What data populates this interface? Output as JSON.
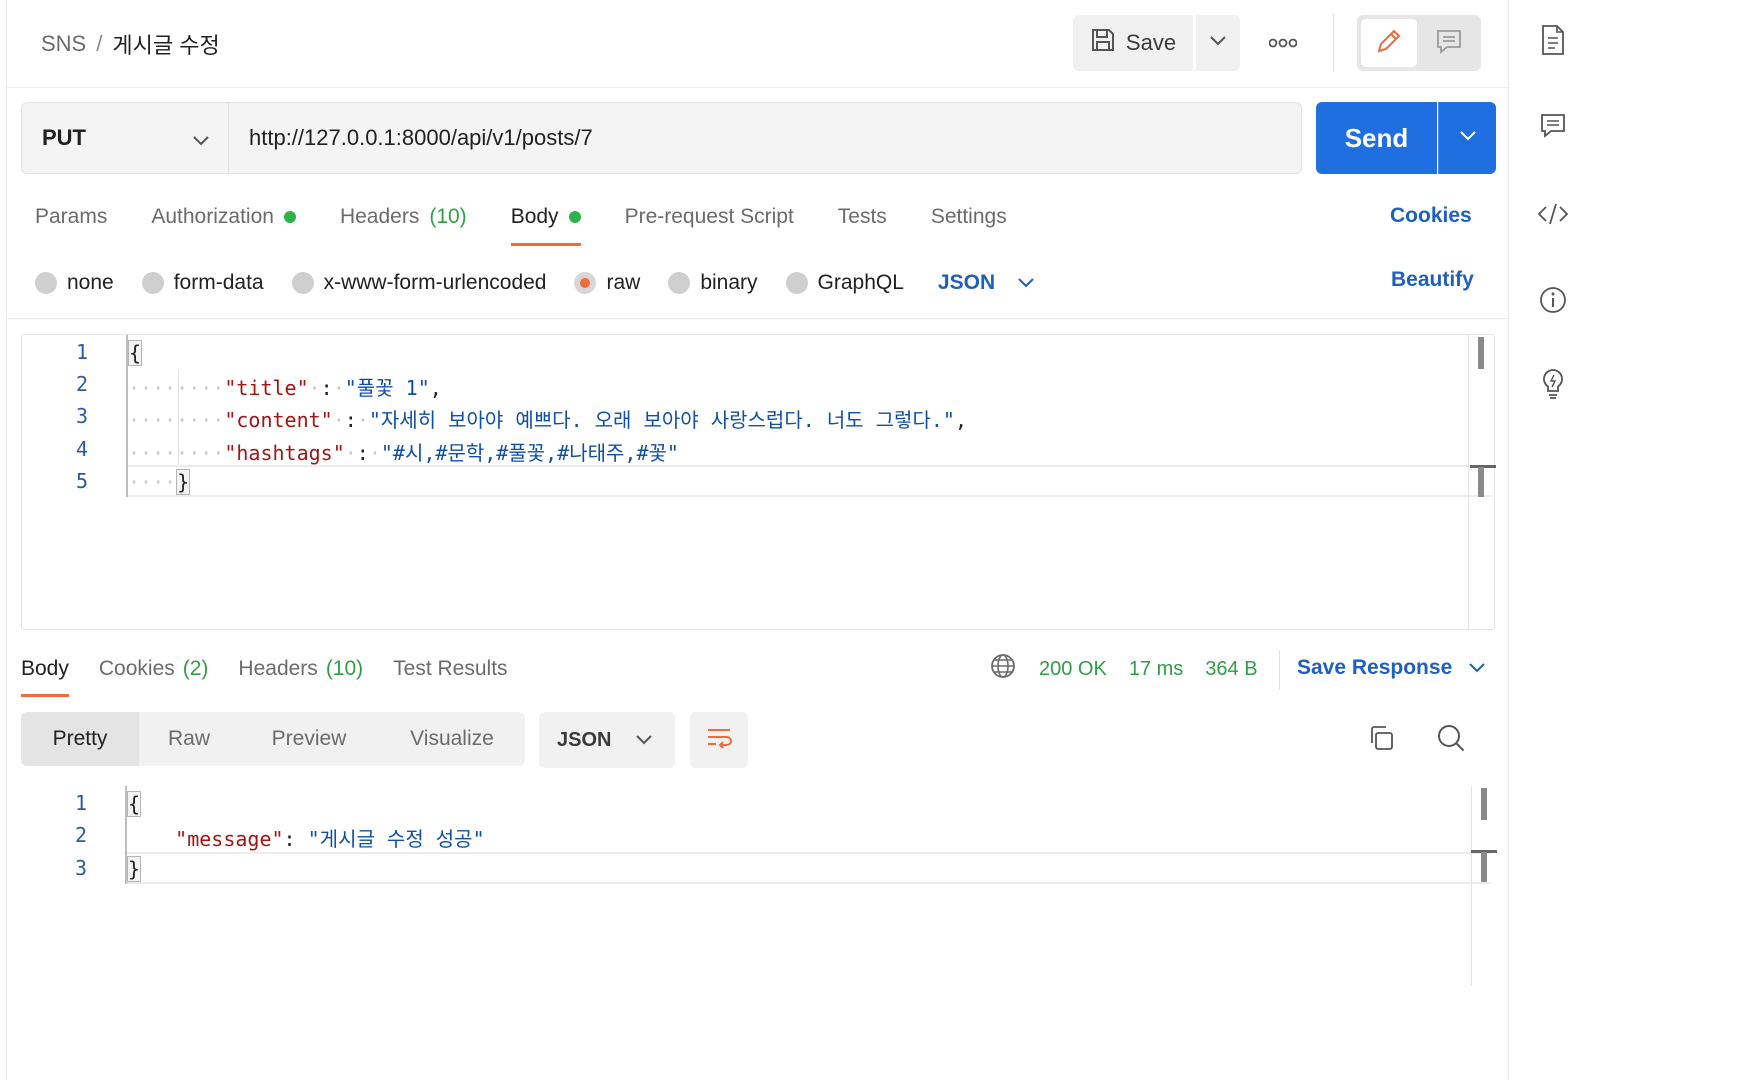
{
  "header": {
    "breadcrumb_root": "SNS",
    "breadcrumb_sep": "/",
    "breadcrumb_current": "게시글 수정",
    "save_label": "Save"
  },
  "request": {
    "method": "PUT",
    "url": "http://127.0.0.1:8000/api/v1/posts/7",
    "send_label": "Send",
    "tabs": {
      "params": "Params",
      "authorization": "Authorization",
      "headers": "Headers",
      "headers_count": "(10)",
      "body": "Body",
      "prerequest": "Pre-request Script",
      "tests": "Tests",
      "settings": "Settings"
    },
    "cookies_label": "Cookies",
    "body_types": {
      "none": "none",
      "form_data": "form-data",
      "urlencoded": "x-www-form-urlencoded",
      "raw": "raw",
      "binary": "binary",
      "graphql": "GraphQL"
    },
    "selected_body_type": "raw",
    "language": "JSON",
    "beautify_label": "Beautify",
    "editor": {
      "line_numbers": [
        "1",
        "2",
        "3",
        "4",
        "5"
      ],
      "open_brace": "{",
      "close_brace": "}",
      "key_title": "\"title\"",
      "val_title": "\"풀꽃 1\"",
      "key_content": "\"content\"",
      "val_content": "\"자세히 보아야 예쁘다. 오래 보아야 사랑스럽다. 너도 그렇다.\"",
      "key_hashtags": "\"hashtags\"",
      "val_hashtags": "\"#시,#문학,#풀꽃,#나태주,#꽃\""
    }
  },
  "response": {
    "tabs": {
      "body": "Body",
      "cookies": "Cookies",
      "cookies_count": "(2)",
      "headers": "Headers",
      "headers_count": "(10)",
      "test_results": "Test Results"
    },
    "status": "200 OK",
    "time": "17 ms",
    "size": "364 B",
    "save_response_label": "Save Response",
    "view_tabs": {
      "pretty": "Pretty",
      "raw": "Raw",
      "preview": "Preview",
      "visualize": "Visualize"
    },
    "language": "JSON",
    "editor": {
      "line_numbers": [
        "1",
        "2",
        "3"
      ],
      "open_brace": "{",
      "close_brace": "}",
      "key_message": "\"message\"",
      "val_message": "\"게시글 수정 성공\""
    }
  },
  "colors": {
    "accent_orange": "#ef6b3b",
    "send_blue": "#1f6fe0",
    "link_blue": "#1f5fbf",
    "status_green": "#2f9e47"
  },
  "icons": {
    "save": "floppy-disk-icon",
    "more": "more-horizontal-icon",
    "edit": "pencil-icon",
    "comment": "comment-icon",
    "docs": "document-icon",
    "code": "code-icon",
    "info": "info-icon",
    "bulb": "lightbulb-icon",
    "globe": "globe-icon",
    "copy": "copy-icon",
    "search": "search-icon",
    "wrap": "wrap-lines-icon"
  }
}
